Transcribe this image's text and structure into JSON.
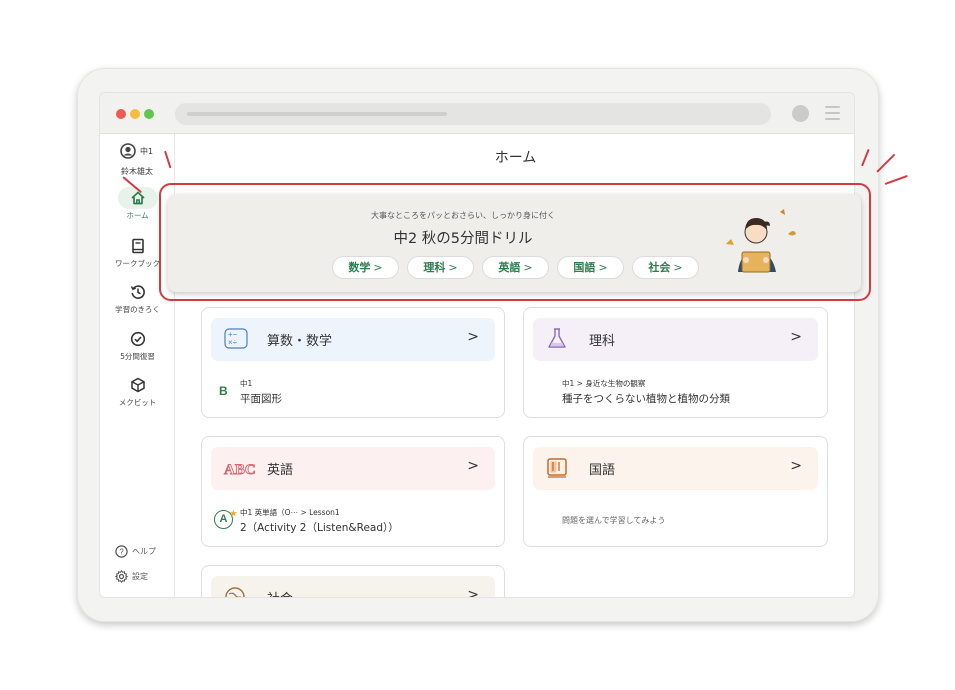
{
  "sidebar": {
    "user_grade": "中1",
    "user_name": "鈴木雄太",
    "items": [
      {
        "label": "ホーム",
        "icon": "home-icon"
      },
      {
        "label": "ワークブック",
        "icon": "book-icon"
      },
      {
        "label": "学習のきろく",
        "icon": "history-icon"
      },
      {
        "label": "5分間復習",
        "icon": "check-circle-icon"
      },
      {
        "label": "メクビット",
        "icon": "cube-icon"
      }
    ],
    "help_label": "ヘルプ",
    "settings_label": "設定"
  },
  "main": {
    "title": "ホーム"
  },
  "banner": {
    "tagline": "大事なところをパッとおさらい、しっかり身に付く",
    "title": "中2 秋の5分間ドリル",
    "subjects": [
      "数学",
      "理科",
      "英語",
      "国語",
      "社会"
    ],
    "arrow": ">"
  },
  "cards": {
    "math": {
      "title": "算数・数学",
      "chevron": ">",
      "badge": "B",
      "sub": "中1",
      "detail": "平面図形",
      "color": "#eef4fb"
    },
    "science": {
      "title": "理科",
      "chevron": ">",
      "sub": "中1 > 身近な生物の観察",
      "detail": "種子をつくらない植物と植物の分類",
      "color": "#f5f0f8"
    },
    "english": {
      "title": "英語",
      "chevron": ">",
      "badge": "A",
      "sub": "中1 英単語（O⋯ > Lesson1",
      "detail": "2（Activity 2（Listen&Read））",
      "color": "#fcf0f1"
    },
    "japanese": {
      "title": "国語",
      "chevron": ">",
      "hint": "問題を選んで学習してみよう",
      "color": "#fcf3ec"
    },
    "social": {
      "title": "社会",
      "chevron": ">",
      "color": "#f6f3ec"
    }
  },
  "colors": {
    "accent_green": "#2e7d4f",
    "highlight_red": "#d53a3f"
  }
}
